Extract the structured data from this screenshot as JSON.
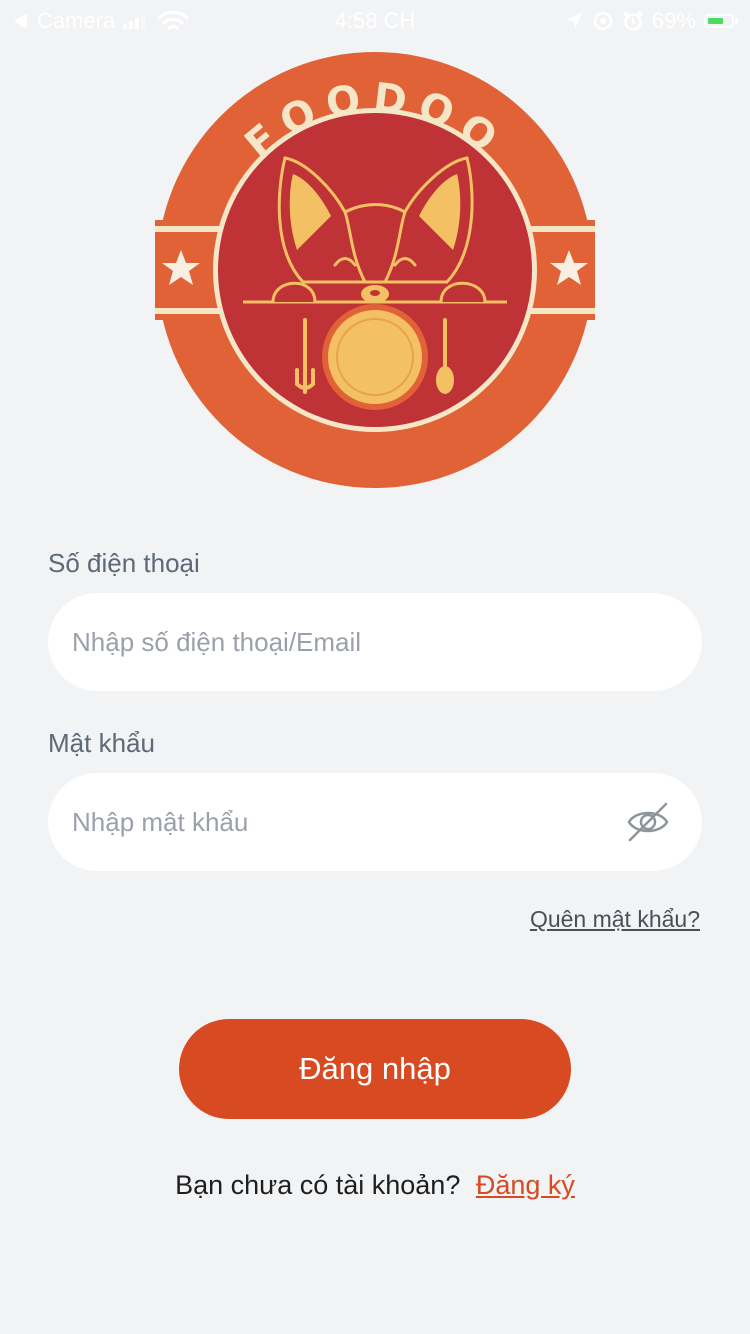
{
  "status_bar": {
    "back_app": "Camera",
    "time": "4:58 CH",
    "battery": "69%",
    "battery_level": 0.69
  },
  "logo": {
    "brand": "FOODOO",
    "colors": {
      "ring": "#e06236",
      "inner": "#bf3236",
      "accent": "#f4c064",
      "line": "#f6e6c8"
    }
  },
  "form": {
    "phone_label": "Số điện thoại",
    "phone_placeholder": "Nhập số điện thoại/Email",
    "password_label": "Mật khẩu",
    "password_placeholder": "Nhập mật khẩu",
    "eye_icon": "eye-off-icon",
    "forgot_label": "Quên mật khẩu?",
    "login_label": "Đăng nhập"
  },
  "signup": {
    "prompt": "Bạn chưa có tài khoản?",
    "link_label": "Đăng ký"
  },
  "theme": {
    "primary": "#d84a22",
    "background": "#f2f3f5"
  }
}
